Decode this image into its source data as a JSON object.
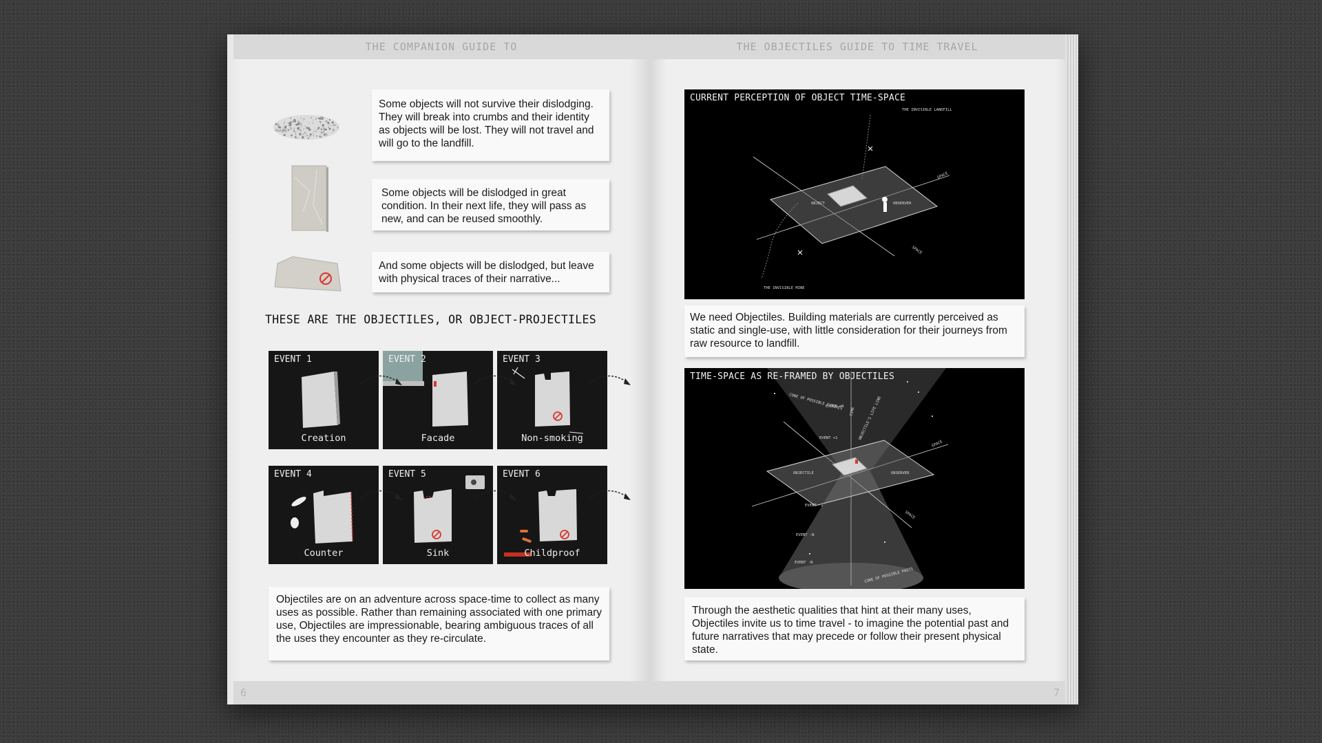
{
  "left_page": {
    "header": "THE COMPANION GUIDE TO",
    "page_number": "6",
    "notes": [
      {
        "text": "Some objects will not survive their dislodging. They will break into crumbs and their identity as objects will be lost. They will not travel and will go to the landfill."
      },
      {
        "text": "Some objects will be dislodged in great condition. In their next life, they will pass as new, and can be reused smoothly."
      },
      {
        "text": "And some objects will be dislodged, but leave with physical traces of their narrative..."
      }
    ],
    "section_title": "THESE ARE THE OBJECTILES, OR OBJECT-PROJECTILES",
    "events": [
      {
        "label": "EVENT 1",
        "caption": "Creation"
      },
      {
        "label": "EVENT 2",
        "caption": "Facade"
      },
      {
        "label": "EVENT 3",
        "caption": "Non-smoking"
      },
      {
        "label": "EVENT 4",
        "caption": "Counter"
      },
      {
        "label": "EVENT 5",
        "caption": "Sink"
      },
      {
        "label": "EVENT 6",
        "caption": "Childproof"
      }
    ],
    "summary": "Objectiles are on an adventure across space-time to collect as many uses as possible. Rather than remaining associated with one primary use, Objectiles are impressionable, bearing ambiguous traces of all the uses they encounter as they re-circulate."
  },
  "right_page": {
    "header": "THE OBJECTILES GUIDE TO TIME TRAVEL",
    "page_number": "7",
    "figure1": {
      "title": "CURRENT PERCEPTION OF OBJECT TIME-SPACE",
      "labels": {
        "landfill": "THE INVISIBLE LANDFILL",
        "mine": "THE INVISIBLE MINE",
        "object": "OBJECT",
        "observer": "OBSERVER",
        "space_a": "SPACE",
        "space_b": "SPACE"
      }
    },
    "caption1": "We need Objectiles. Building materials are currently perceived as static and single-use, with little consideration for their journeys from raw resource to landfill.",
    "figure2": {
      "title": "TIME-SPACE AS RE-FRAMED BY OBJECTILES",
      "labels": {
        "futures": "CONE OF POSSIBLE FUTURES",
        "pasts": "CONE OF POSSIBLE PASTS",
        "objectile": "OBJECTILE",
        "observer": "OBSERVER",
        "space_a": "SPACE",
        "space_b": "SPACE",
        "time": "TIME",
        "lifeline": "OBJECTILE'S LIFE LINE",
        "event_n1": "EVENT +N",
        "event_a": "EVENT +1",
        "event_b": "EVENT -1",
        "event_c": "EVENT -N",
        "event_d": "EVENT -N"
      }
    },
    "caption2": "Through the aesthetic qualities that hint at their many uses, Objectiles invite us to time travel - to imagine the potential past and future narratives that may precede or follow their present physical state."
  },
  "colors": {
    "background": "#3c3c3c",
    "page": "#efefef",
    "header_band": "#d9d9d9",
    "panel": "#161616",
    "figure": "#000000",
    "accent_red": "#d9372b"
  },
  "icons": [
    "crumbs-icon",
    "marble-tile-icon",
    "marked-tile-icon",
    "curved-arrow-icon",
    "no-smoking-icon"
  ]
}
